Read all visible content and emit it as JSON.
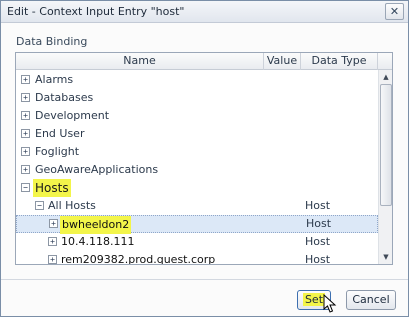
{
  "window": {
    "title": "Edit - Context Input Entry \"host\"",
    "close_glyph": "✕"
  },
  "group_label": "Data Binding",
  "table": {
    "columns": [
      "Name",
      "Value",
      "Data Type"
    ],
    "rows": [
      {
        "name": "Alarms",
        "expander": "+",
        "data_type": ""
      },
      {
        "name": "Databases",
        "expander": "+",
        "data_type": ""
      },
      {
        "name": "Development",
        "expander": "+",
        "data_type": ""
      },
      {
        "name": "End User",
        "expander": "+",
        "data_type": ""
      },
      {
        "name": "Foglight",
        "expander": "+",
        "data_type": ""
      },
      {
        "name": "GeoAwareApplications",
        "expander": "+",
        "data_type": ""
      },
      {
        "name": "Hosts",
        "expander": "−",
        "data_type": "",
        "highlighted": true
      },
      {
        "name": "All Hosts",
        "expander": "−",
        "data_type": "Host"
      },
      {
        "name": "bwheeldon2",
        "expander": "+",
        "data_type": "Host",
        "selected": true,
        "highlighted": true
      },
      {
        "name": "10.4.118.111",
        "expander": "+",
        "data_type": "Host"
      },
      {
        "name": "rem209382.prod.quest.corp",
        "expander": "+",
        "data_type": "Host"
      }
    ]
  },
  "scrollbar": {
    "up_glyph": "▲",
    "down_glyph": "▼"
  },
  "buttons": {
    "set": "Set",
    "cancel": "Cancel"
  },
  "colors": {
    "highlight": "#f3f54a",
    "selection": "#dce8f7"
  }
}
